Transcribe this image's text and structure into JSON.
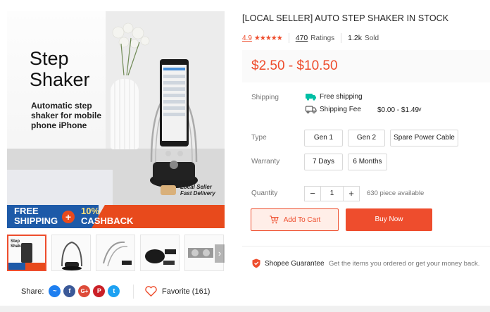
{
  "product": {
    "title": "[LOCAL SELLER] AUTO STEP SHAKER IN STOCK",
    "rating": "4.9",
    "stars": "★★★★★",
    "ratings_count": "470",
    "ratings_label": "Ratings",
    "sold_count": "1.2k",
    "sold_label": "Sold",
    "price": "$2.50 - $10.50"
  },
  "image": {
    "title_line1": "Step",
    "title_line2": "Shaker",
    "subtitle": "Automatic step shaker for mobile phone iPhone",
    "delivery_line1": "Local Seller",
    "delivery_line2": "Fast Delivery",
    "promo_line1a": "FREE",
    "promo_line1b": "SHIPPING",
    "promo_plus": "+",
    "promo_line2a": "10%",
    "promo_line2b": "CASHBACK",
    "thumb_title": "Step Shaker"
  },
  "shipping": {
    "label": "Shipping",
    "free": "Free shipping",
    "fee_label": "Shipping Fee",
    "fee_range": "$0.00 - $1.49"
  },
  "variations": {
    "type_label": "Type",
    "types": [
      "Gen 1",
      "Gen 2",
      "Spare Power Cable"
    ],
    "warranty_label": "Warranty",
    "warranties": [
      "7 Days",
      "6 Months"
    ]
  },
  "quantity": {
    "label": "Quantity",
    "minus": "−",
    "value": "1",
    "plus": "+",
    "available": "630 piece available"
  },
  "actions": {
    "add_to_cart": "Add To Cart",
    "buy_now": "Buy Now"
  },
  "guarantee": {
    "title": "Shopee Guarantee",
    "text": "Get the items you ordered or get your money back."
  },
  "share": {
    "label": "Share:",
    "favorite": "Favorite (161)"
  },
  "colors": {
    "accent": "#ee4d2d",
    "messenger": "#1e7ff0",
    "facebook": "#3b5998",
    "google": "#dd4b39",
    "pinterest": "#cb2027",
    "twitter": "#1da1f2"
  }
}
